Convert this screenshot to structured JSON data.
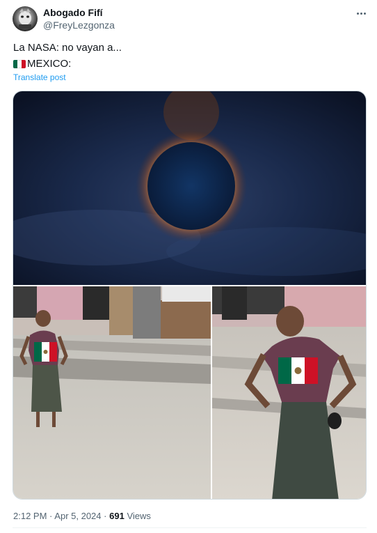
{
  "author": {
    "display_name": "Abogado Fifí",
    "handle": "@FreyLezgonza"
  },
  "post": {
    "line1": "La NASA: no vayan a...",
    "line2": "MEXICO:",
    "translate_label": "Translate post"
  },
  "flag_colors": {
    "green": "#006847",
    "white": "#ffffff",
    "red": "#ce1126"
  },
  "icons": {
    "more": "more-horizontal-icon",
    "flag": "mexico-flag-icon"
  },
  "footer": {
    "time": "2:12 PM",
    "separator": "·",
    "date": "Apr 5, 2024",
    "views_count": "691",
    "views_label": "Views"
  },
  "colors": {
    "link": "#1d9bf0",
    "secondary_text": "#536471",
    "primary_text": "#0f1419"
  }
}
